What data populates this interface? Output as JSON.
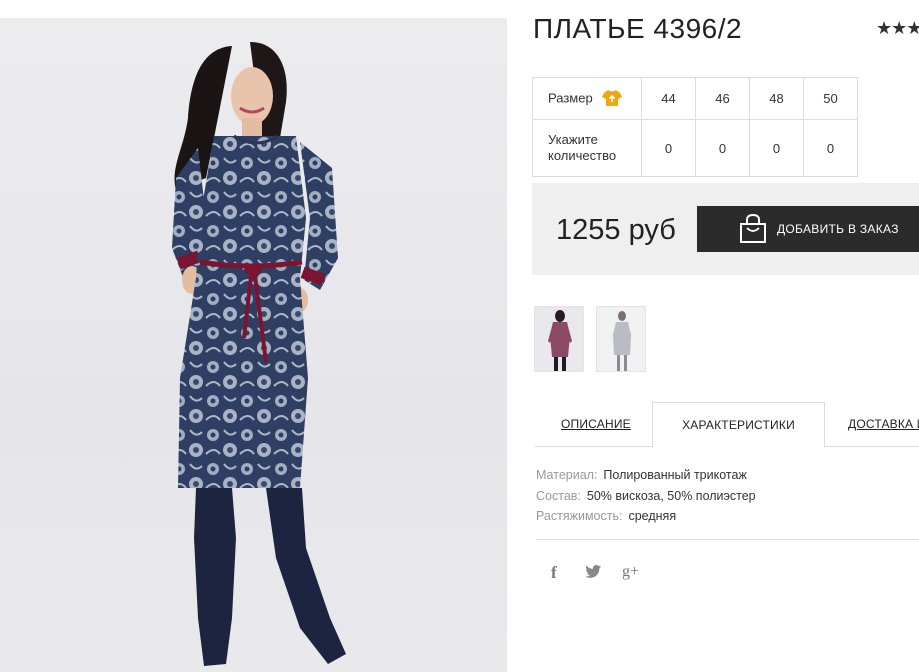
{
  "product": {
    "title": "ПЛАТЬЕ 4396/2",
    "rating_stars": "★★★"
  },
  "size_table": {
    "size_label": "Размер",
    "qty_label_line1": "Укажите",
    "qty_label_line2": "количество",
    "sizes": [
      "44",
      "46",
      "48",
      "50"
    ],
    "quantities": [
      "0",
      "0",
      "0",
      "0"
    ],
    "size_icon": "tshirt-icon"
  },
  "purchase": {
    "price": "1255 руб",
    "add_button_label": "ДОБАВИТЬ В ЗАКАЗ",
    "button_icon": "shopping-bag-icon"
  },
  "tabs": [
    {
      "label": "ОПИСАНИЕ"
    },
    {
      "label": "ХАРАКТЕРИСТИКИ"
    },
    {
      "label": "ДОСТАВКА И"
    }
  ],
  "specs": [
    {
      "label": "Материал:",
      "value": "Полированный трикотаж"
    },
    {
      "label": "Состав:",
      "value": "50% вискоза, 50% полиэстер"
    },
    {
      "label": "Растяжимость:",
      "value": "средняя"
    }
  ],
  "social": {
    "facebook": "f",
    "twitter": "🐦",
    "googleplus": "g+"
  },
  "colors": {
    "dress_navy": "#2e3e61",
    "belt_burgundy": "#7a1431",
    "button_dark": "#2b2b2b",
    "icon_gold": "#e8a911",
    "price_bg": "#efefef"
  }
}
